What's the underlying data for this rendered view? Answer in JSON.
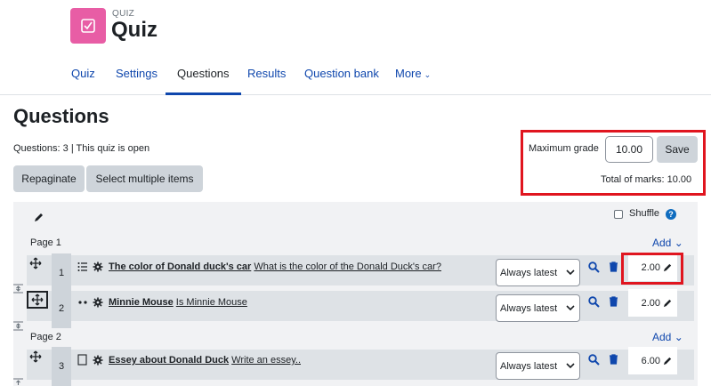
{
  "header": {
    "kicker": "QUIZ",
    "title": "Quiz",
    "icon": "quiz-checkbox-icon",
    "accent_color": "#e85da5"
  },
  "nav": {
    "items": [
      {
        "label": "Quiz"
      },
      {
        "label": "Settings"
      },
      {
        "label": "Questions"
      },
      {
        "label": "Results"
      },
      {
        "label": "Question bank"
      },
      {
        "label": "More"
      }
    ],
    "active": "Questions"
  },
  "page": {
    "title": "Questions",
    "status": "Questions: 3 | This quiz is open"
  },
  "buttons": {
    "repaginate": "Repaginate",
    "select_multiple": "Select multiple items"
  },
  "grade": {
    "label": "Maximum grade",
    "value": "10.00",
    "save": "Save",
    "total_marks": "Total of marks: 10.00"
  },
  "shuffle": {
    "label": "Shuffle",
    "help": "?",
    "checked": false
  },
  "pages": [
    {
      "label": "Page 1",
      "add": "Add"
    },
    {
      "label": "Page 2",
      "add": "Add"
    }
  ],
  "questions": [
    {
      "num": "1",
      "type_icon": "multiple-choice-icon",
      "name": "The color of Donald duck's car",
      "text": "What is the color of the Donald Duck's car?",
      "version": "Always latest",
      "mark": "2.00"
    },
    {
      "num": "2",
      "type_icon": "true-false-icon",
      "name": "Minnie Mouse",
      "text": "Is Minnie Mouse",
      "version": "Always latest",
      "mark": "2.00"
    },
    {
      "num": "3",
      "type_icon": "essay-icon",
      "name": "Essey about Donald Duck",
      "text": "Write an essey..",
      "version": "Always latest",
      "mark": "6.00"
    }
  ],
  "colors": {
    "link": "#0f47ad",
    "highlight": "#e0151f",
    "panel": "#f1f2f4",
    "row": "#dee2e6"
  }
}
